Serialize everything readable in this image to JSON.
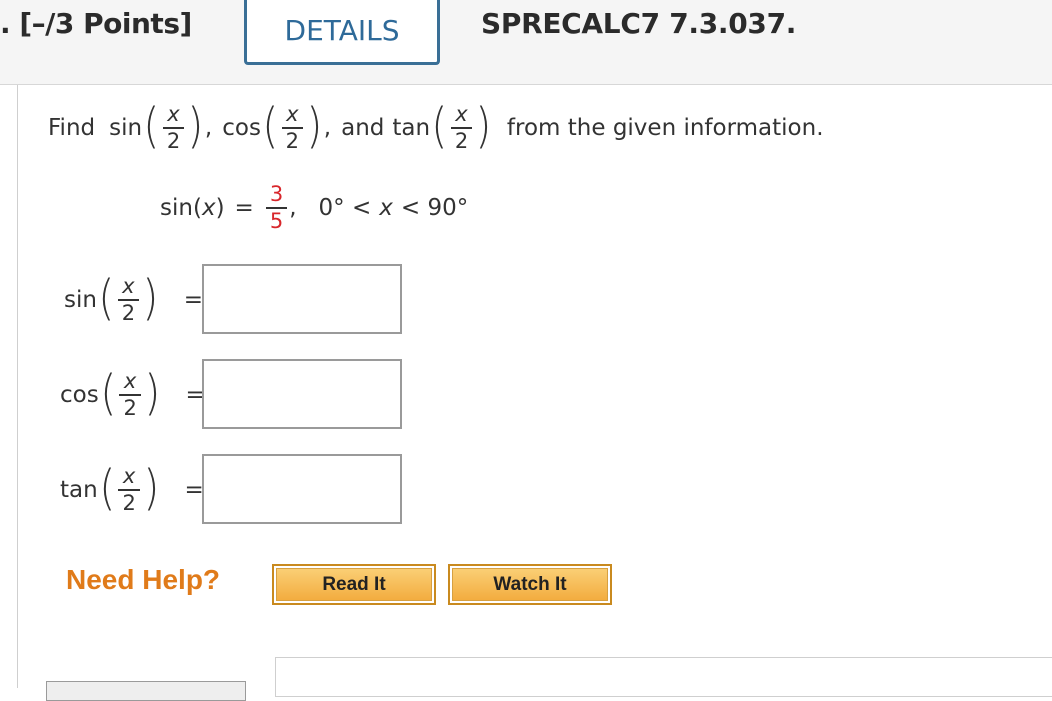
{
  "header": {
    "points": ". [–/3 Points]",
    "details_tab": "DETAILS",
    "problem_ref": "SPRECALC7 7.3.037."
  },
  "prompt": {
    "find": "Find",
    "sin": "sin",
    "cos": "cos",
    "tan": "tan",
    "x": "x",
    "two": "2",
    "comma": ",",
    "and": "and",
    "from_given": "from the given information."
  },
  "given": {
    "lhs": "sin(",
    "var": "x",
    "rhs_paren": ")",
    "equals": "=",
    "numerator": "3",
    "denominator": "5",
    "comma": ",",
    "constraint_left": "0° <",
    "constraint_var": "x",
    "constraint_right": "< 90°"
  },
  "answers": [
    {
      "func": "sin",
      "value": ""
    },
    {
      "func": "cos",
      "value": ""
    },
    {
      "func": "tan",
      "value": ""
    }
  ],
  "answer_equals": "=",
  "help": {
    "label": "Need Help?",
    "read_it": "Read It",
    "watch_it": "Watch It"
  },
  "colors": {
    "tab_border": "#3a6f96",
    "fraction_red": "#d8262b",
    "need_help": "#e07b1a",
    "button_fill": "#f2a93a"
  }
}
